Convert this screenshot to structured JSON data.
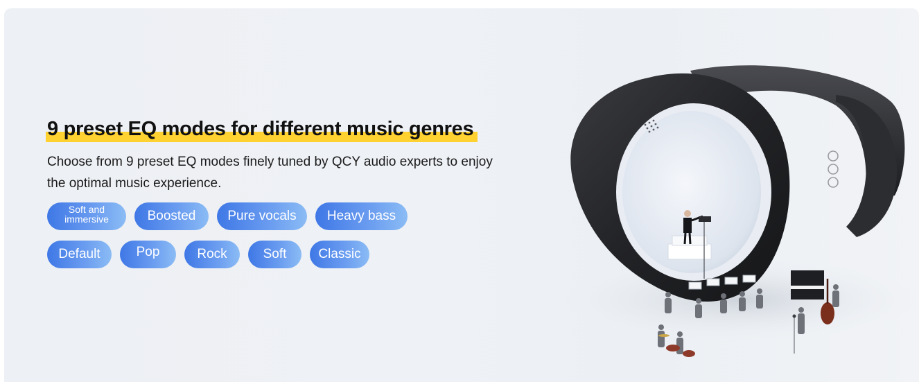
{
  "headline": "9 preset EQ modes for different music genres",
  "description": "Choose from 9 preset EQ modes finely tuned by QCY audio experts to enjoy the optimal music experience.",
  "eq_modes": {
    "row1": [
      "Soft and immersive",
      "Boosted",
      "Pure vocals",
      "Heavy bass"
    ],
    "row2": [
      "Default",
      "Pop",
      "Rock",
      "Soft",
      "Classic"
    ]
  },
  "product_brand": "QCY",
  "colors": {
    "highlight": "#ffd232",
    "pill_start": "#3f78e6",
    "pill_end": "#8bbcf5",
    "headphone": "#2a2b2e"
  }
}
